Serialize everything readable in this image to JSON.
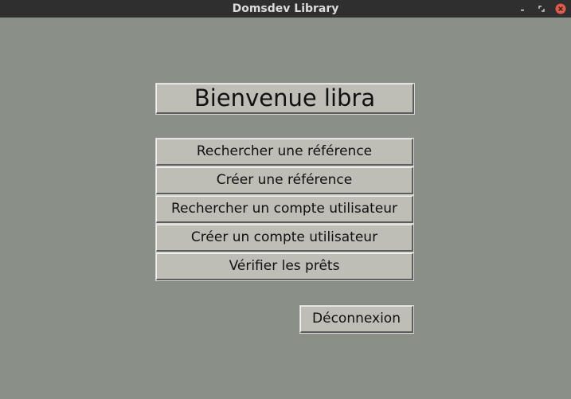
{
  "window": {
    "title": "Domsdev Library",
    "controls": [
      "minimize-icon",
      "maximize-icon",
      "close-icon"
    ],
    "close_color": "#e05b4a"
  },
  "main": {
    "heading": "Bienvenue libra",
    "menu": [
      {
        "label": "Rechercher une référence"
      },
      {
        "label": "Créer une référence"
      },
      {
        "label": "Rechercher un compte utilisateur"
      },
      {
        "label": "Créer un compte utilisateur"
      },
      {
        "label": "Vérifier les prêts"
      }
    ],
    "logout_label": "Déconnexion"
  }
}
